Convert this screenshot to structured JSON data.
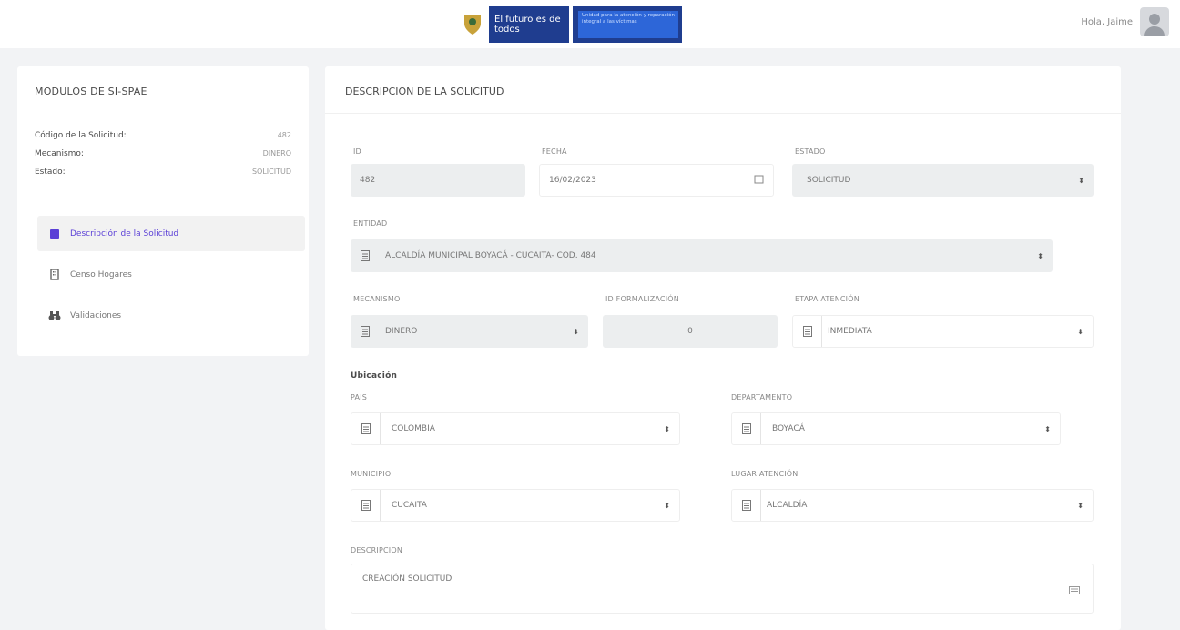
{
  "header": {
    "logo_brand": "El futuro es de todos",
    "logo_unit": "Unidad para la atención y reparación integral a las víctimas",
    "greeting": "Hola, Jaime"
  },
  "sidebar": {
    "title": "MODULOS DE SI-SPAE",
    "info": [
      {
        "label": "Código de la Solicitud:",
        "value": "482"
      },
      {
        "label": "Mecanismo:",
        "value": "DINERO"
      },
      {
        "label": "Estado:",
        "value": "SOLICITUD"
      }
    ],
    "nav": [
      {
        "label": "Descripción de la Solicitud",
        "icon": "file-icon",
        "active": true
      },
      {
        "label": "Censo Hogares",
        "icon": "building-icon",
        "active": false
      },
      {
        "label": "Validaciones",
        "icon": "binoculars-icon",
        "active": false
      }
    ]
  },
  "main": {
    "title": "DESCRIPCION DE LA SOLICITUD",
    "id": {
      "label": "ID",
      "value": "482"
    },
    "fecha": {
      "label": "FECHA",
      "value": "16/02/2023"
    },
    "estado": {
      "label": "ESTADO",
      "value": "SOLICITUD"
    },
    "entidad": {
      "label": "ENTIDAD",
      "value": "ALCALDÍA MUNICIPAL BOYACÁ - CUCAITA- COD. 484"
    },
    "mecanismo": {
      "label": "MECANISMO",
      "value": "DINERO"
    },
    "id_formalizacion": {
      "label": "ID FORMALIZACIÓN",
      "value": "0"
    },
    "etapa_atencion": {
      "label": "ETAPA ATENCIÓN",
      "value": "INMEDIATA"
    },
    "ubicacion": {
      "label": "Ubicación"
    },
    "pais": {
      "label": "PAIS",
      "value": "COLOMBIA"
    },
    "departamento": {
      "label": "DEPARTAMENTO",
      "value": "BOYACÁ"
    },
    "municipio": {
      "label": "MUNICIPIO",
      "value": "CUCAITA"
    },
    "lugar_atencion": {
      "label": "LUGAR ATENCIÓN",
      "value": "ALCALDÍA"
    },
    "descripcion": {
      "label": "DESCRIPCION",
      "value": "CREACIÓN SOLICITUD"
    }
  }
}
